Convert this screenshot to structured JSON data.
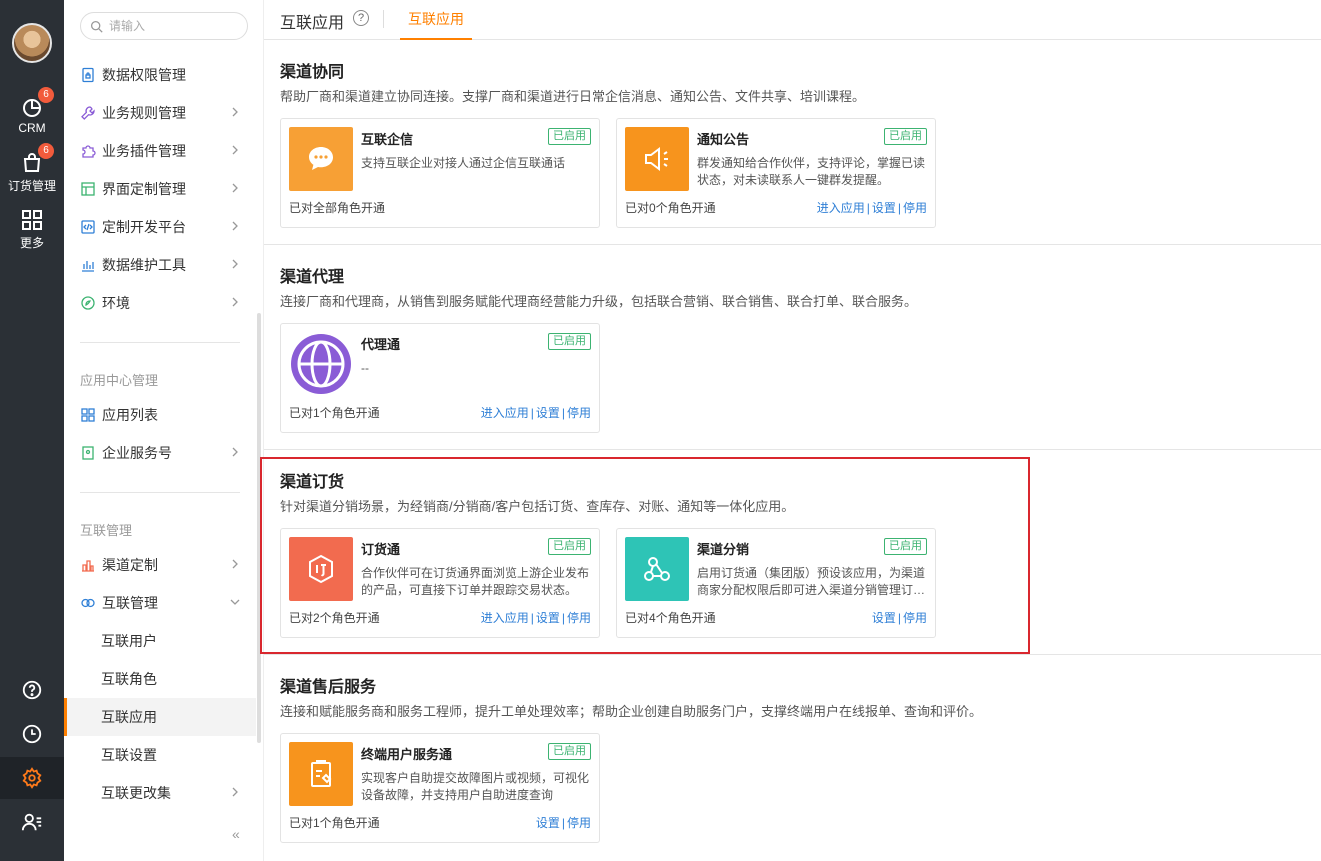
{
  "rail": {
    "items": [
      {
        "label": "CRM",
        "badge": "6"
      },
      {
        "label": "订货管理",
        "badge": "6"
      },
      {
        "label": "更多",
        "badge": ""
      }
    ]
  },
  "sidebar": {
    "search_placeholder": "请输入",
    "items": [
      {
        "label": "数据权限管理"
      },
      {
        "label": "业务规则管理"
      },
      {
        "label": "业务插件管理"
      },
      {
        "label": "界面定制管理"
      },
      {
        "label": "定制开发平台"
      },
      {
        "label": "数据维护工具"
      },
      {
        "label": "环境"
      }
    ],
    "group_app_center": "应用中心管理",
    "app_items": [
      {
        "label": "应用列表"
      },
      {
        "label": "企业服务号"
      }
    ],
    "group_interconnect": "互联管理",
    "inter_items": [
      {
        "label": "渠道定制"
      },
      {
        "label": "互联管理"
      }
    ],
    "sub_items": [
      {
        "label": "互联用户"
      },
      {
        "label": "互联角色"
      },
      {
        "label": "互联应用"
      },
      {
        "label": "互联设置"
      },
      {
        "label": "互联更改集"
      }
    ],
    "collapse": "«"
  },
  "header": {
    "title": "互联应用",
    "help": "?",
    "tab": "互联应用"
  },
  "sections": [
    {
      "title": "渠道协同",
      "desc": "帮助厂商和渠道建立协同连接。支撑厂商和渠道进行日常企信消息、通知公告、文件共享、培训课程。",
      "cards": [
        {
          "name": "互联企信",
          "tag": "已启用",
          "desc": "支持互联企业对接人通过企信互联通话",
          "foot": "已对全部角色开通",
          "links": [],
          "color": "#f7a035"
        },
        {
          "name": "通知公告",
          "tag": "已启用",
          "desc": "群发通知给合作伙伴，支持评论，掌握已读状态，对未读联系人一键群发提醒。",
          "foot": "已对0个角色开通",
          "links": [
            "进入应用",
            "设置",
            "停用"
          ],
          "color": "#f7941d"
        }
      ]
    },
    {
      "title": "渠道代理",
      "desc": "连接厂商和代理商，从销售到服务赋能代理商经营能力升级，包括联合营销、联合销售、联合打单、联合服务。",
      "cards": [
        {
          "name": "代理通",
          "tag": "已启用",
          "desc": "--",
          "foot": "已对1个角色开通",
          "links": [
            "进入应用",
            "设置",
            "停用"
          ],
          "color": "#8a5cd6"
        }
      ]
    },
    {
      "title": "渠道订货",
      "desc": "针对渠道分销场景，为经销商/分销商/客户包括订货、查库存、对账、通知等一体化应用。",
      "cards": [
        {
          "name": "订货通",
          "tag": "已启用",
          "desc": "合作伙伴可在订货通界面浏览上游企业发布的产品，可直接下订单并跟踪交易状态。",
          "foot": "已对2个角色开通",
          "links": [
            "进入应用",
            "设置",
            "停用"
          ],
          "color": "#f26b4f"
        },
        {
          "name": "渠道分销",
          "tag": "已启用",
          "desc": "启用订货通（集团版）预设该应用，为渠道商家分配权限后即可进入渠道分销管理订…",
          "foot": "已对4个角色开通",
          "links": [
            "设置",
            "停用"
          ],
          "color": "#2ec4b6"
        }
      ]
    },
    {
      "title": "渠道售后服务",
      "desc": "连接和赋能服务商和服务工程师，提升工单处理效率；帮助企业创建自助服务门户，支撑终端用户在线报单、查询和评价。",
      "cards": [
        {
          "name": "终端用户服务通",
          "tag": "已启用",
          "desc": "实现客户自助提交故障图片或视频，可视化设备故障，并支持用户自助进度查询",
          "foot": "已对1个角色开通",
          "links": [
            "设置",
            "停用"
          ],
          "color": "#f7941d"
        }
      ]
    }
  ]
}
